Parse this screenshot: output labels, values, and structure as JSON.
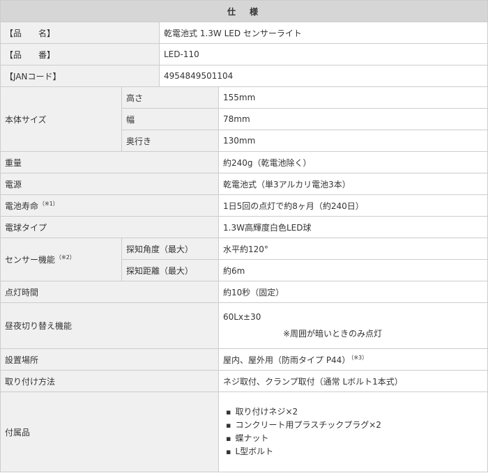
{
  "title": "仕　様",
  "rows": {
    "name": {
      "label": "【品　　名】",
      "value": "乾電池式 1.3W LED センサーライト"
    },
    "model": {
      "label": "【品　　番】",
      "value": "LED-110"
    },
    "jan": {
      "label": "【JANコード】",
      "value": "4954849501104"
    },
    "size": {
      "label": "本体サイズ",
      "height": {
        "label": "高さ",
        "value": "155mm"
      },
      "width": {
        "label": "幅",
        "value": "78mm"
      },
      "depth": {
        "label": "奥行き",
        "value": "130mm"
      }
    },
    "weight": {
      "label": "重量",
      "value": "約240g（乾電池除く）"
    },
    "power": {
      "label": "電源",
      "value": "乾電池式（単3アルカリ電池3本）"
    },
    "battery_life": {
      "label": "電池寿命",
      "note": "（※1）",
      "value": "1日5回の点灯で約8ヶ月（約240日）"
    },
    "bulb": {
      "label": "電球タイプ",
      "value": "1.3W高輝度白色LED球"
    },
    "sensor": {
      "label": "センサー機能",
      "note": "（※2）",
      "angle": {
        "label": "探知角度（最大）",
        "value": "水平約120°"
      },
      "distance": {
        "label": "探知距離（最大）",
        "value": "約6m"
      }
    },
    "duration": {
      "label": "点灯時間",
      "value": "約10秒（固定）"
    },
    "daynight": {
      "label": "昼夜切り替え機能",
      "value": "60Lx±30",
      "note": "※周囲が暗いときのみ点灯"
    },
    "location": {
      "label": "設置場所",
      "value": "屋内、屋外用（防雨タイプ P44）",
      "note": "（※3）"
    },
    "mounting": {
      "label": "取り付け方法",
      "value": "ネジ取付、クランプ取付（通常 Lボルト1本式）"
    },
    "accessories": {
      "label": "付属品",
      "items": [
        "取り付けネジ×2",
        "コンクリート用プラスチックプラグ×2",
        "蝶ナット",
        "L型ボルト"
      ]
    }
  }
}
